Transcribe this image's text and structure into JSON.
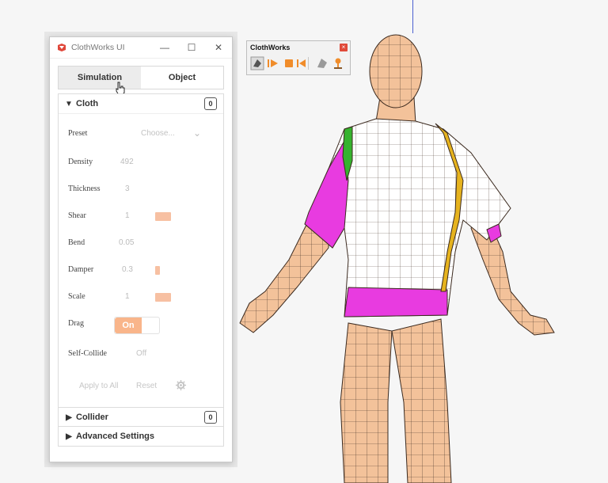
{
  "window": {
    "title": "ClothWorks UI",
    "minimize": "—",
    "maximize": "☐",
    "close": "✕"
  },
  "tabs": [
    {
      "label": "Simulation"
    },
    {
      "label": "Object"
    }
  ],
  "cloth": {
    "title": "Cloth",
    "count": "0",
    "preset": {
      "label": "Preset",
      "placeholder": "Choose..."
    },
    "density": {
      "label": "Density",
      "value": "492"
    },
    "thickness": {
      "label": "Thickness",
      "value": "3"
    },
    "shear": {
      "label": "Shear",
      "value": "1",
      "level": 0.2
    },
    "bend": {
      "label": "Bend",
      "value": "0.05"
    },
    "damper": {
      "label": "Damper",
      "value": "0.3",
      "level": 0.06
    },
    "scale": {
      "label": "Scale",
      "value": "1",
      "level": 0.2
    },
    "drag": {
      "label": "Drag",
      "value": "On"
    },
    "self_collide": {
      "label": "Self-Collide",
      "value": "Off"
    },
    "actions": {
      "apply_all": "Apply to All",
      "reset": "Reset"
    }
  },
  "collider": {
    "title": "Collider",
    "count": "0"
  },
  "advanced": {
    "title": "Advanced Settings"
  },
  "toolbar": {
    "title": "ClothWorks"
  },
  "colors": {
    "accent": "#f9b58a",
    "garment_magenta": "#e83be0",
    "garment_yellow": "#e6b31e",
    "garment_green": "#35b32e",
    "skin": "#f3c29a"
  },
  "icons": [
    "app-logo-icon",
    "hand-pointer-cursor-icon",
    "chevron-down-icon",
    "chevron-right-icon",
    "gear-icon",
    "reset-to-start-icon",
    "play-icon",
    "stop-icon",
    "rewind-icon",
    "cloth-select-icon",
    "pin-icon"
  ]
}
